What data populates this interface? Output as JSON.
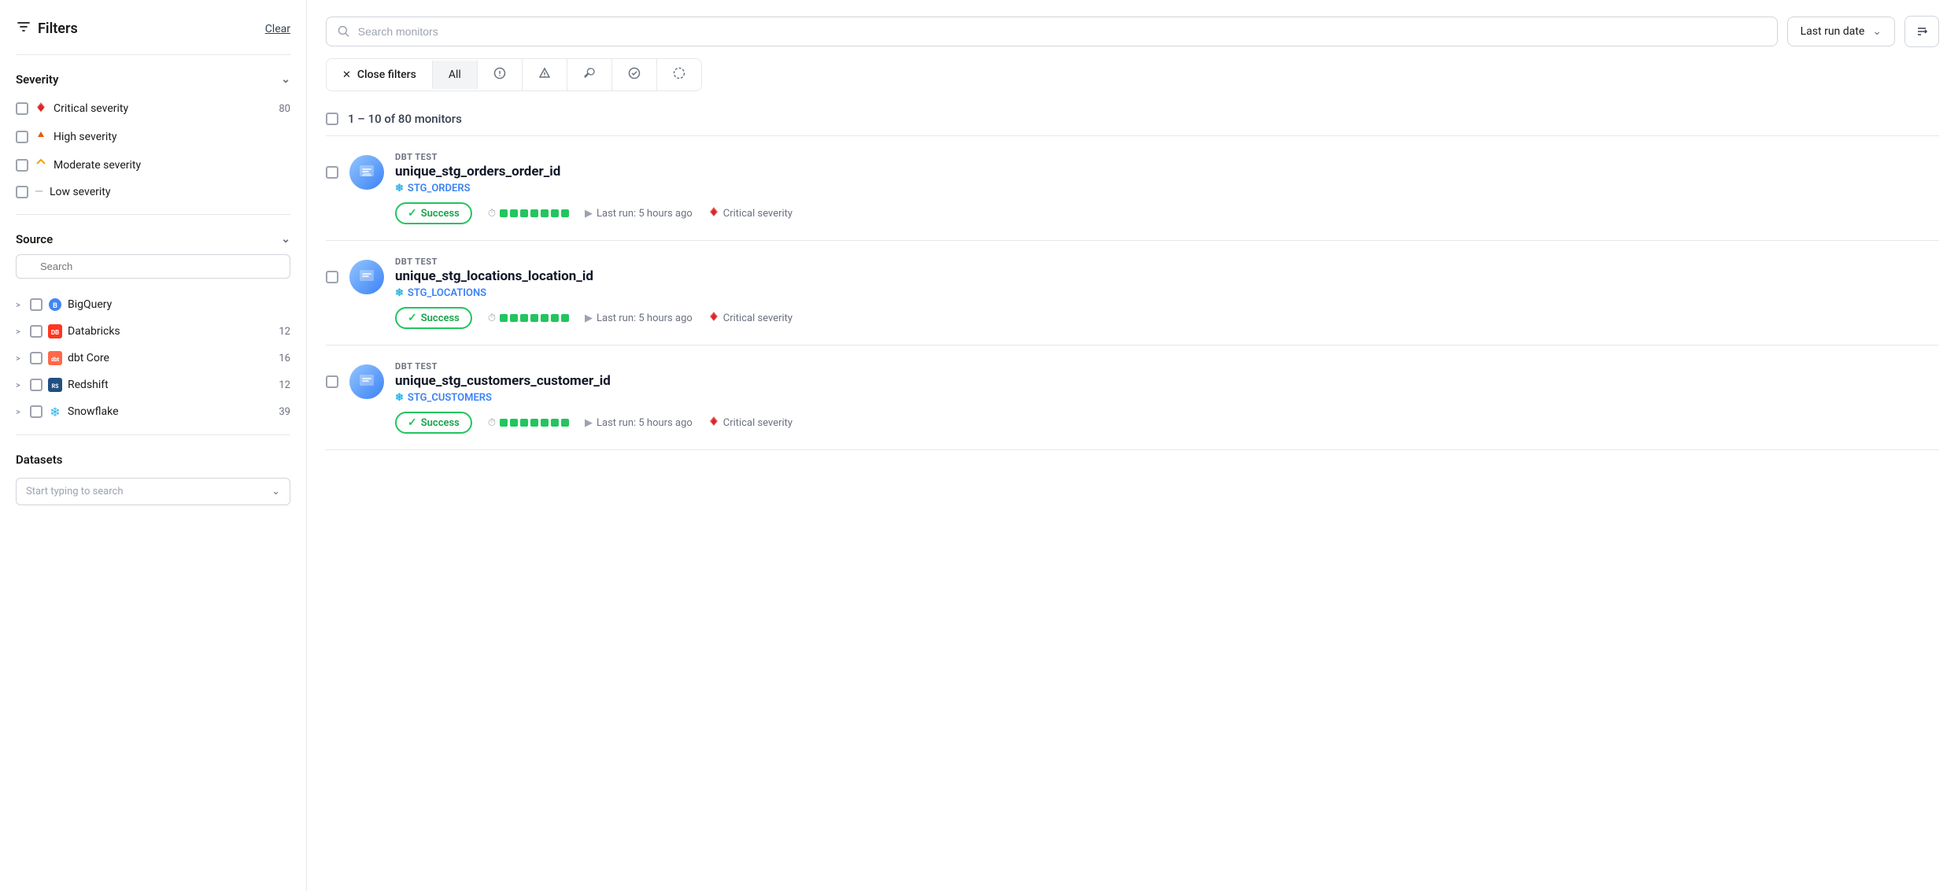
{
  "sidebar": {
    "title": "Filters",
    "clear_label": "Clear",
    "severity": {
      "label": "Severity",
      "items": [
        {
          "label": "Critical severity",
          "count": "80",
          "level": "critical"
        },
        {
          "label": "High severity",
          "count": "",
          "level": "high"
        },
        {
          "label": "Moderate severity",
          "count": "",
          "level": "moderate"
        },
        {
          "label": "Low severity",
          "count": "",
          "level": "low"
        }
      ]
    },
    "source": {
      "label": "Source",
      "search_placeholder": "Search",
      "items": [
        {
          "label": "BigQuery",
          "count": "",
          "icon": "bigquery"
        },
        {
          "label": "Databricks",
          "count": "12",
          "icon": "databricks"
        },
        {
          "label": "dbt Core",
          "count": "16",
          "icon": "dbt"
        },
        {
          "label": "Redshift",
          "count": "12",
          "icon": "redshift"
        },
        {
          "label": "Snowflake",
          "count": "39",
          "icon": "snowflake"
        }
      ]
    },
    "datasets": {
      "label": "Datasets",
      "search_placeholder": "Start typing to search"
    }
  },
  "main": {
    "search_placeholder": "Search monitors",
    "sort_label": "Last run date",
    "filter_tabs": [
      {
        "label": "Close filters",
        "type": "close"
      },
      {
        "label": "All",
        "active": true
      },
      {
        "label": "!",
        "type": "icon"
      },
      {
        "label": "△",
        "type": "icon"
      },
      {
        "label": "🔧",
        "type": "icon"
      },
      {
        "label": "✓",
        "type": "icon"
      },
      {
        "label": "◌",
        "type": "icon"
      }
    ],
    "results_count": "1 – 10 of 80 monitors",
    "monitors": [
      {
        "type": "DBT TEST",
        "name": "unique_stg_orders_order_id",
        "source_label": "STG_ORDERS",
        "status": "Success",
        "last_run": "Last run: 5 hours ago",
        "severity": "Critical severity"
      },
      {
        "type": "DBT TEST",
        "name": "unique_stg_locations_location_id",
        "source_label": "STG_LOCATIONS",
        "status": "Success",
        "last_run": "Last run: 5 hours ago",
        "severity": "Critical severity"
      },
      {
        "type": "DBT TEST",
        "name": "unique_stg_customers_customer_id",
        "source_label": "STG_CUSTOMERS",
        "status": "Success",
        "last_run": "Last run: 5 hours ago",
        "severity": "Critical severity"
      }
    ]
  },
  "icons": {
    "filter": "⊿",
    "search": "🔍",
    "chevron_down": "∨",
    "close": "✕",
    "check": "✓",
    "play": "▷",
    "clock": "⏱",
    "snowflake": "❄",
    "sort": "⇅"
  }
}
